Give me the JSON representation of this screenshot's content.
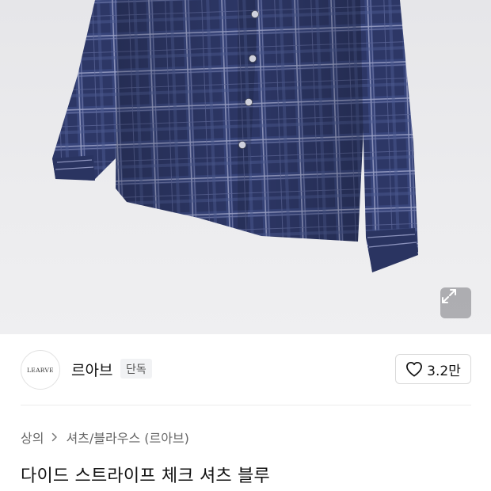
{
  "hero": {
    "image_alt": "navy plaid check shirt",
    "zoom_icon": "expand-icon"
  },
  "brand": {
    "logo_text": "LEARVE",
    "name": "르아브",
    "badge": "단독"
  },
  "like": {
    "icon": "heart-icon",
    "count": "3.2만"
  },
  "breadcrumb": {
    "items": [
      "상의",
      "셔츠/블라우스 (르아브)"
    ],
    "separator_icon": "chevron-right-icon"
  },
  "product": {
    "title": "다이드 스트라이프 체크 셔츠 블루"
  },
  "colors": {
    "shirt_base": "#2f3a6b",
    "shirt_check": "#8b92b8",
    "background": "#ffffff",
    "badge_bg": "#f1f2f4"
  }
}
